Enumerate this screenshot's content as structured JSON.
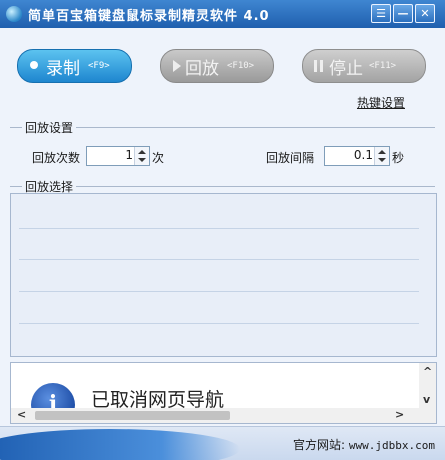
{
  "window": {
    "title": "简单百宝箱键盘鼠标录制精灵软件 4.0",
    "menu_glyph": "☰",
    "min_glyph": "—",
    "close_glyph": "✕"
  },
  "toolbar": {
    "record_label": "录制",
    "record_key": "<F9>",
    "play_label": "回放",
    "play_key": "<F10>",
    "stop_label": "停止",
    "stop_key": "<F11>"
  },
  "hotkey_link": "热键设置",
  "playback_settings": {
    "group_title": "回放设置",
    "count_label": "回放次数",
    "count_value": "1",
    "count_unit": "次",
    "interval_label": "回放间隔",
    "interval_value": "0.1",
    "interval_unit": "秒"
  },
  "playback_select": {
    "group_title": "回放选择",
    "items": []
  },
  "browser": {
    "message": "已取消网页导航"
  },
  "footer": {
    "site_label": "官方网站:",
    "site_url": "www.jdbbx.com"
  },
  "colors": {
    "titlebar": "#2a6fc0",
    "record_button": "#1e86cf",
    "disabled_button": "#a8a8a8",
    "background": "#eef3fb"
  }
}
